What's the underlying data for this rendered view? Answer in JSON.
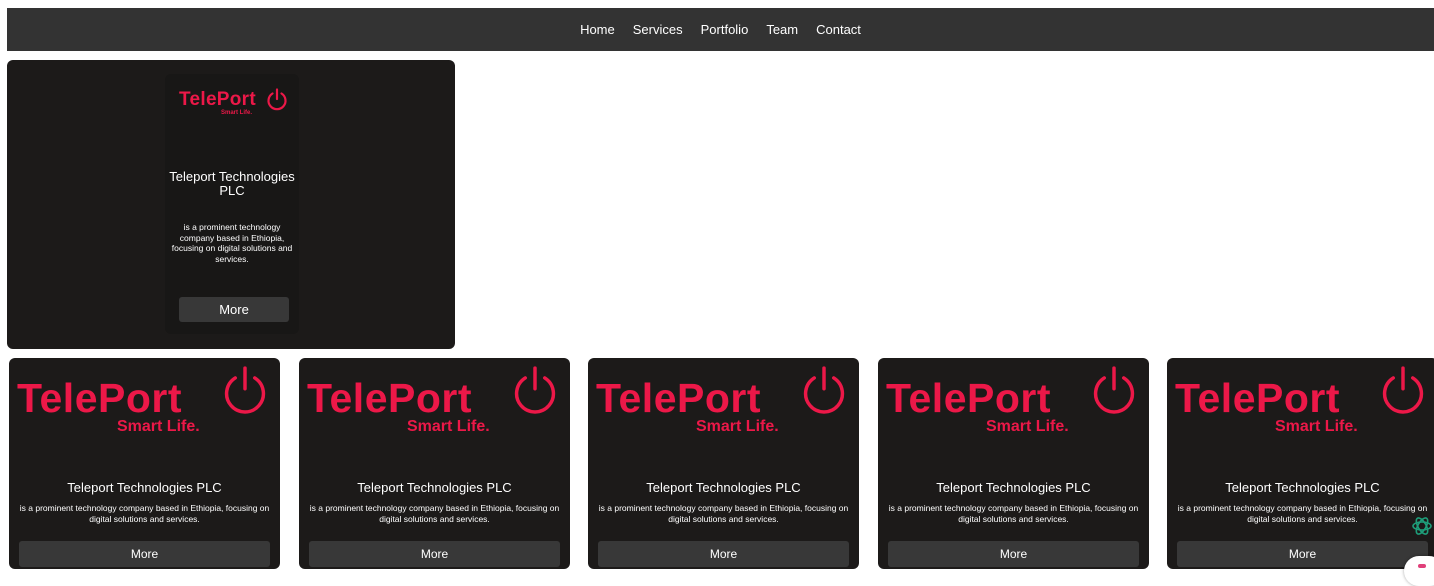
{
  "nav": {
    "items": [
      "Home",
      "Services",
      "Portfolio",
      "Team",
      "Contact"
    ]
  },
  "logo": {
    "word": "TelePort",
    "tagline": "Smart Life.",
    "icon": "power-icon",
    "color": "#ec1848"
  },
  "featured": {
    "title": "Teleport Technologies PLC",
    "description": "is a prominent technology company based in Ethiopia, focusing on digital solutions and services.",
    "button": "More"
  },
  "cards": [
    {
      "title": "Teleport Technologies PLC",
      "description": "is a prominent technology company based in Ethiopia, focusing on digital solutions and services.",
      "button": "More"
    },
    {
      "title": "Teleport Technologies PLC",
      "description": "is a prominent technology company based in Ethiopia, focusing on digital solutions and services.",
      "button": "More"
    },
    {
      "title": "Teleport Technologies PLC",
      "description": "is a prominent technology company based in Ethiopia, focusing on digital solutions and services.",
      "button": "More"
    },
    {
      "title": "Teleport Technologies PLC",
      "description": "is a prominent technology company based in Ethiopia, focusing on digital solutions and services.",
      "button": "More"
    },
    {
      "title": "Teleport Technologies PLC",
      "description": "is a prominent technology company based in Ethiopia, focusing on digital solutions and services.",
      "button": "More"
    }
  ],
  "widget": {
    "icon": "ai-assistant-icon",
    "badge_icon": "chat-badge-icon"
  },
  "colors": {
    "navbar": "#333333",
    "card": "#1c1a19",
    "button": "#383838",
    "brand": "#ec1848"
  }
}
